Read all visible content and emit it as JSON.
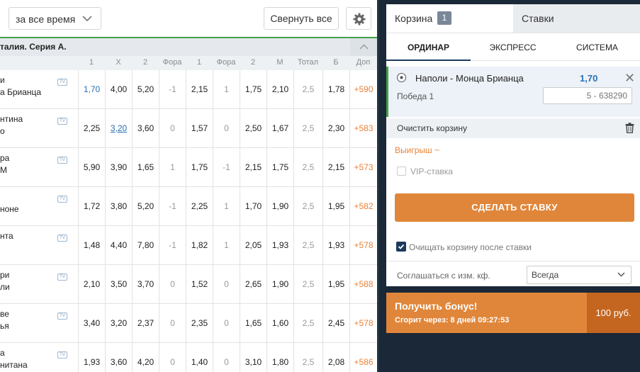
{
  "toolbar": {
    "period": "за все время",
    "collapse_all": "Свернуть все"
  },
  "league": {
    "title": "талия. Серия А."
  },
  "columns": [
    "1",
    "X",
    "2",
    "Фора",
    "1",
    "Фора",
    "2",
    "М",
    "Тотал",
    "Б",
    "Доп"
  ],
  "rows": [
    {
      "team1": "и",
      "team2": "а Брианца",
      "o1": "1,70",
      "ox": "4,00",
      "o2": "5,20",
      "h1": "-1",
      "hc1": "2,15",
      "h2": "1",
      "hc2": "1,75",
      "m": "2,10",
      "total": "2,5",
      "b": "1,78",
      "more": "+590"
    },
    {
      "team1": "нтина",
      "team2": "о",
      "o1": "2,25",
      "ox": "3,20",
      "o2": "3,60",
      "h1": "0",
      "hc1": "1,57",
      "h2": "0",
      "hc2": "2,50",
      "m": "1,67",
      "total": "2,5",
      "b": "2,30",
      "more": "+583"
    },
    {
      "team1": "ра",
      "team2": "М",
      "o1": "5,90",
      "ox": "3,90",
      "o2": "1,65",
      "h1": "1",
      "hc1": "1,75",
      "h2": "-1",
      "hc2": "2,15",
      "m": "1,75",
      "total": "2,5",
      "b": "2,15",
      "more": "+573"
    },
    {
      "team1": "",
      "team2": "ноне",
      "o1": "1,72",
      "ox": "3,80",
      "o2": "5,20",
      "h1": "-1",
      "hc1": "2,25",
      "h2": "1",
      "hc2": "1,70",
      "m": "1,90",
      "total": "2,5",
      "b": "1,95",
      "more": "+582"
    },
    {
      "team1": "нта",
      "team2": "",
      "o1": "1,48",
      "ox": "4,40",
      "o2": "7,80",
      "h1": "-1",
      "hc1": "1,82",
      "h2": "1",
      "hc2": "2,05",
      "m": "1,93",
      "total": "2,5",
      "b": "1,93",
      "more": "+578"
    },
    {
      "team1": "ри",
      "team2": "ли",
      "o1": "2,10",
      "ox": "3,50",
      "o2": "3,70",
      "h1": "0",
      "hc1": "1,52",
      "h2": "0",
      "hc2": "2,65",
      "m": "1,90",
      "total": "2,5",
      "b": "1,95",
      "more": "+588"
    },
    {
      "team1": "ве",
      "team2": "ья",
      "o1": "3,40",
      "ox": "3,20",
      "o2": "2,37",
      "h1": "0",
      "hc1": "2,35",
      "h2": "0",
      "hc2": "1,65",
      "m": "1,60",
      "total": "2,5",
      "b": "2,45",
      "more": "+578"
    },
    {
      "team1": "а",
      "team2": "нитана",
      "o1": "1,93",
      "ox": "3,60",
      "o2": "4,20",
      "h1": "0",
      "hc1": "1,40",
      "h2": "0",
      "hc2": "3,10",
      "m": "1,80",
      "total": "2,5",
      "b": "2,08",
      "more": "+586"
    }
  ],
  "tv_label": "TV",
  "cart": {
    "tab_label": "Корзина",
    "count": "1",
    "bets_tab": "Ставки",
    "subtabs": [
      "ОРДИНАР",
      "ЭКСПРЕСС",
      "СИСТЕМА"
    ],
    "bet": {
      "match": "Наполи - Монца Брианца",
      "odd": "1,70",
      "outcome": "Победа 1",
      "stake_placeholder": "5 - 638290"
    },
    "clear": "Очистить корзину",
    "winnings": "Выигрыш ~",
    "vip": "VIP-ставка",
    "place_bet": "СДЕЛАТЬ СТАВКУ",
    "auto_clear": "Очищать корзину после ставки",
    "agree_label": "Соглашаться с изм. кф.",
    "agree_value": "Всегда"
  },
  "bonus": {
    "title": "Получить бонус!",
    "subtitle": "Сгорит через: 8 дней 09:27:53",
    "amount": "100 руб."
  },
  "colors": {
    "accent": "#e0863a",
    "navy": "#1b3a5c",
    "odd_blue": "#2a6fb5",
    "green": "#43a047"
  }
}
